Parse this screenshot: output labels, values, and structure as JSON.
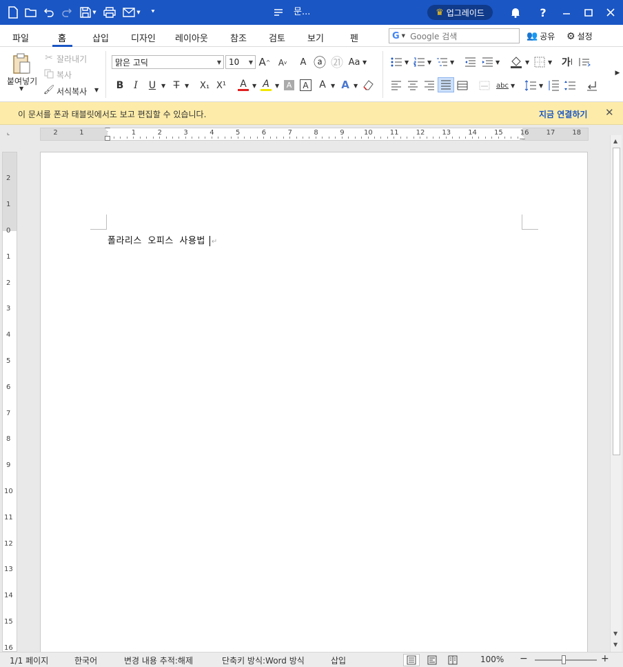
{
  "titlebar": {
    "title": "문...",
    "upgrade_label": "업그레이드",
    "help_label": "?",
    "icons": [
      "new-doc-icon",
      "open-folder-icon",
      "undo-icon",
      "redo-icon",
      "save-icon",
      "print-icon",
      "mail-icon",
      "customize-icon",
      "doc-title-icon",
      "crown-icon",
      "bell-icon",
      "minimize-icon",
      "maximize-icon",
      "close-icon"
    ]
  },
  "menubar": {
    "tabs": [
      "파일",
      "홈",
      "삽입",
      "디자인",
      "레이아웃",
      "참조",
      "검토",
      "보기",
      "펜"
    ],
    "active_tab": "홈",
    "search_placeholder": "Google 검색",
    "share_label": "공유",
    "settings_label": "설정"
  },
  "ribbon": {
    "paste_label": "붙여넣기",
    "cut_label": "잘라내기",
    "copy_label": "복사",
    "format_painter_label": "서식복사",
    "font_name": "맑은 고딕",
    "font_size": "10",
    "bold": "B",
    "italic": "I",
    "underline": "U",
    "strike": "T",
    "subscript": "X₁",
    "superscript": "X¹",
    "font_grow": "A",
    "font_shrink": "A",
    "phonetic": "A",
    "enclose_a": "ⓐ",
    "enclose_21": "㉑",
    "change_case": "Aa",
    "font_color": "A",
    "highlight": "A",
    "char_shade": "A",
    "char_border": "A",
    "char_spacing": "A",
    "text_effect": "A",
    "para_korean": "가",
    "colors": {
      "font_color": "#e02020",
      "highlight": "#f2e600",
      "accent": "#1a56c4"
    }
  },
  "infobar": {
    "message": "이 문서를 폰과 태블릿에서도 보고 편집할 수 있습니다.",
    "link": "지금 연결하기"
  },
  "ruler": {
    "h_left": [
      "2",
      "1"
    ],
    "h_right": [
      "1",
      "2",
      "3",
      "4",
      "5",
      "6",
      "7",
      "8",
      "9",
      "10",
      "11",
      "12",
      "13",
      "14",
      "15",
      "16",
      "17",
      "18"
    ],
    "v_top": [
      "2",
      "1",
      "0"
    ],
    "v_bottom": [
      "1",
      "2",
      "3",
      "4",
      "5",
      "6",
      "7",
      "8",
      "9",
      "10",
      "11",
      "12",
      "13",
      "14",
      "15",
      "16"
    ]
  },
  "document": {
    "text": "폴라리스 오피스 사용법",
    "para_mark": "↵"
  },
  "statusbar": {
    "page": "1/1 페이지",
    "language": "한국어",
    "track_changes": "변경 내용 추적:해제",
    "shortcut_mode": "단축키 방식:Word 방식",
    "insert_mode": "삽입",
    "zoom": "100%",
    "zoom_minus": "−",
    "zoom_plus": "+"
  }
}
